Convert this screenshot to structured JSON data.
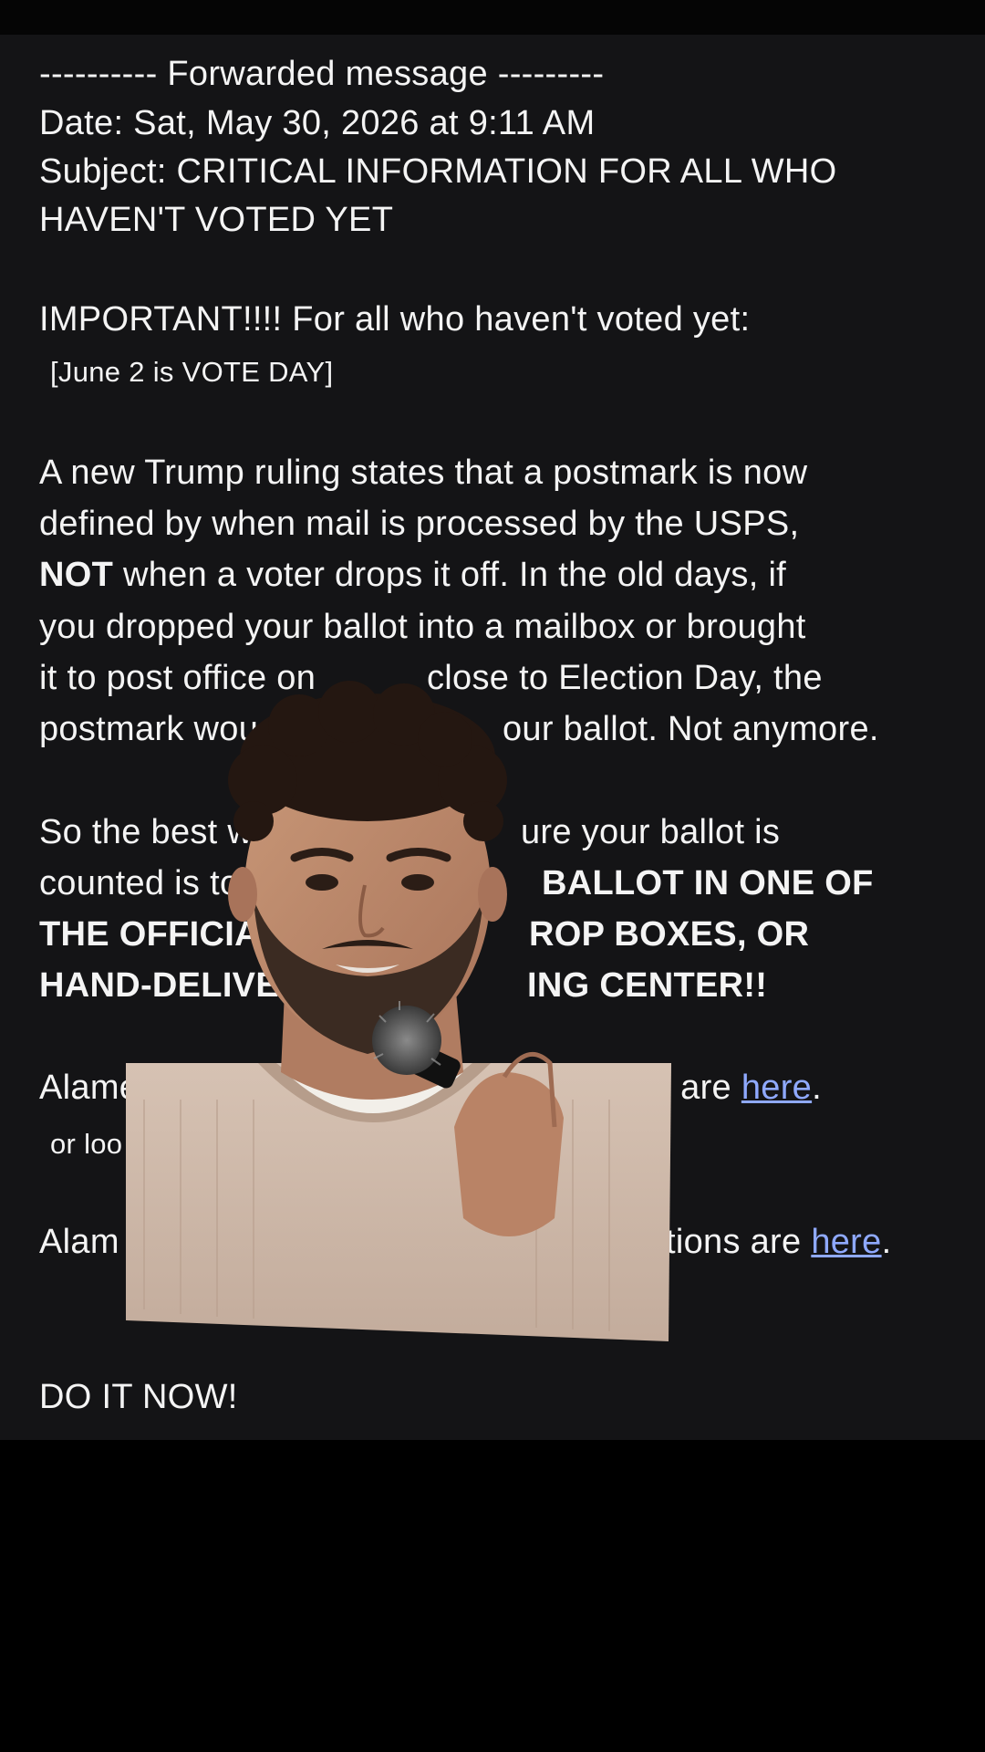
{
  "email": {
    "forward_header": "---------- Forwarded message ---------",
    "date_line": "Date: Sat, May 30, 2026 at 9:11 AM",
    "subject_line_1": "Subject: CRITICAL INFORMATION FOR ALL WHO",
    "subject_line_2": "HAVEN'T VOTED YET",
    "important": "IMPORTANT!!!!  For all who haven't voted yet:",
    "vote_day": "[June 2 is VOTE DAY]",
    "p1_l1": "A new Trump ruling states that a postmark is now",
    "p1_l2": "defined by when mail is processed by the USPS,",
    "p1_l3_bold": "NOT",
    "p1_l3_rest": " when a voter drops it off.  In the old days, if",
    "p1_l4": "you dropped your ballot into a mailbox or brought",
    "p1_l5a": "it to post office on",
    "p1_l5b": "close to Election Day, the",
    "p1_l6a": "postmark wou",
    "p1_l6b": "our ballot. Not anymore.",
    "p2_l1a": "So the best w",
    "p2_l1b": "ure your ballot is",
    "p2_l2a": "counted is to",
    "p2_l2b": "BALLOT IN ONE OF",
    "p2_l3a": "THE OFFICIA",
    "p2_l3b": "ROP BOXES, OR",
    "p2_l4a": "HAND-DELIVE",
    "p2_l4b": "ING CENTER!!",
    "alameda1_a": "Alame",
    "alameda1_b": "s are ",
    "link_here_1": "here",
    "period": ".",
    "or_loo": "or loo",
    "alameda2_a": "Alam",
    "alameda2_b": "tions are ",
    "link_here_2": "here",
    "closing": "DO IT NOW!"
  },
  "overlay": {
    "name": "speaker-webcam"
  },
  "colors": {
    "panel_bg": "#141416",
    "text": "#f4f4f4",
    "link": "#8fa9ff",
    "page_bg": "#000000"
  }
}
